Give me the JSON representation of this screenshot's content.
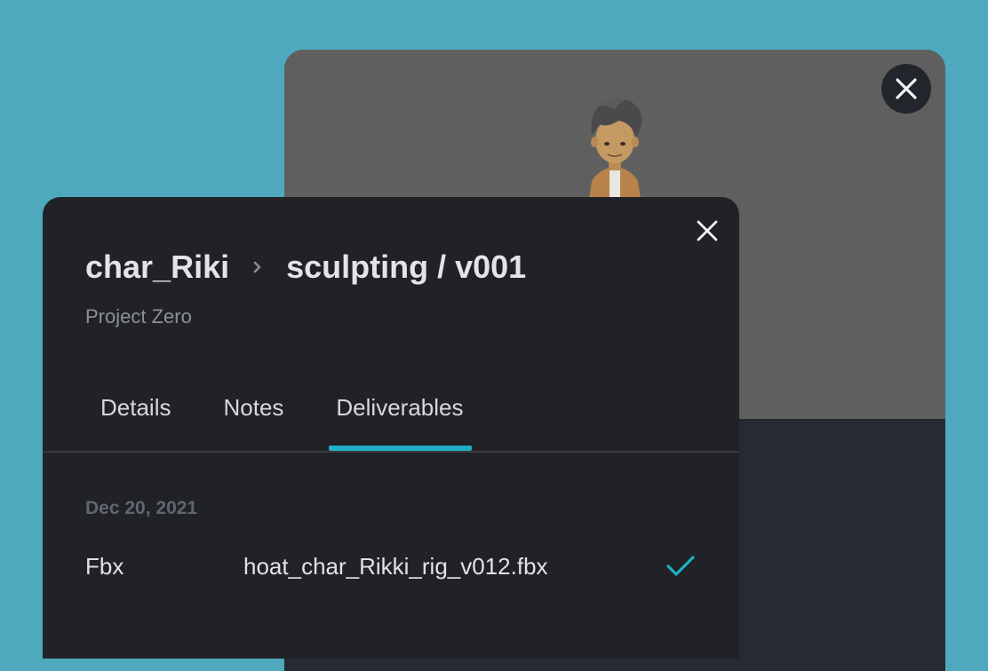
{
  "preview": {
    "close_icon": "close-icon",
    "viewport_color": "#5f5f5f"
  },
  "panel": {
    "breadcrumb": {
      "asset": "char_Riki",
      "separator_icon": "chevron-right-icon",
      "task": "sculpting / v001"
    },
    "project": "Project Zero",
    "close_icon": "close-icon",
    "tabs": [
      {
        "label": "Details",
        "active": false
      },
      {
        "label": "Notes",
        "active": false
      },
      {
        "label": "Deliverables",
        "active": true
      }
    ],
    "accent_color": "#1fb0c6",
    "deliverables": {
      "groups": [
        {
          "date": "Dec 20, 2021",
          "items": [
            {
              "type": "Fbx",
              "file": "hoat_char_Rikki_rig_v012.fbx",
              "status_icon": "checkmark-icon"
            }
          ]
        }
      ]
    }
  }
}
